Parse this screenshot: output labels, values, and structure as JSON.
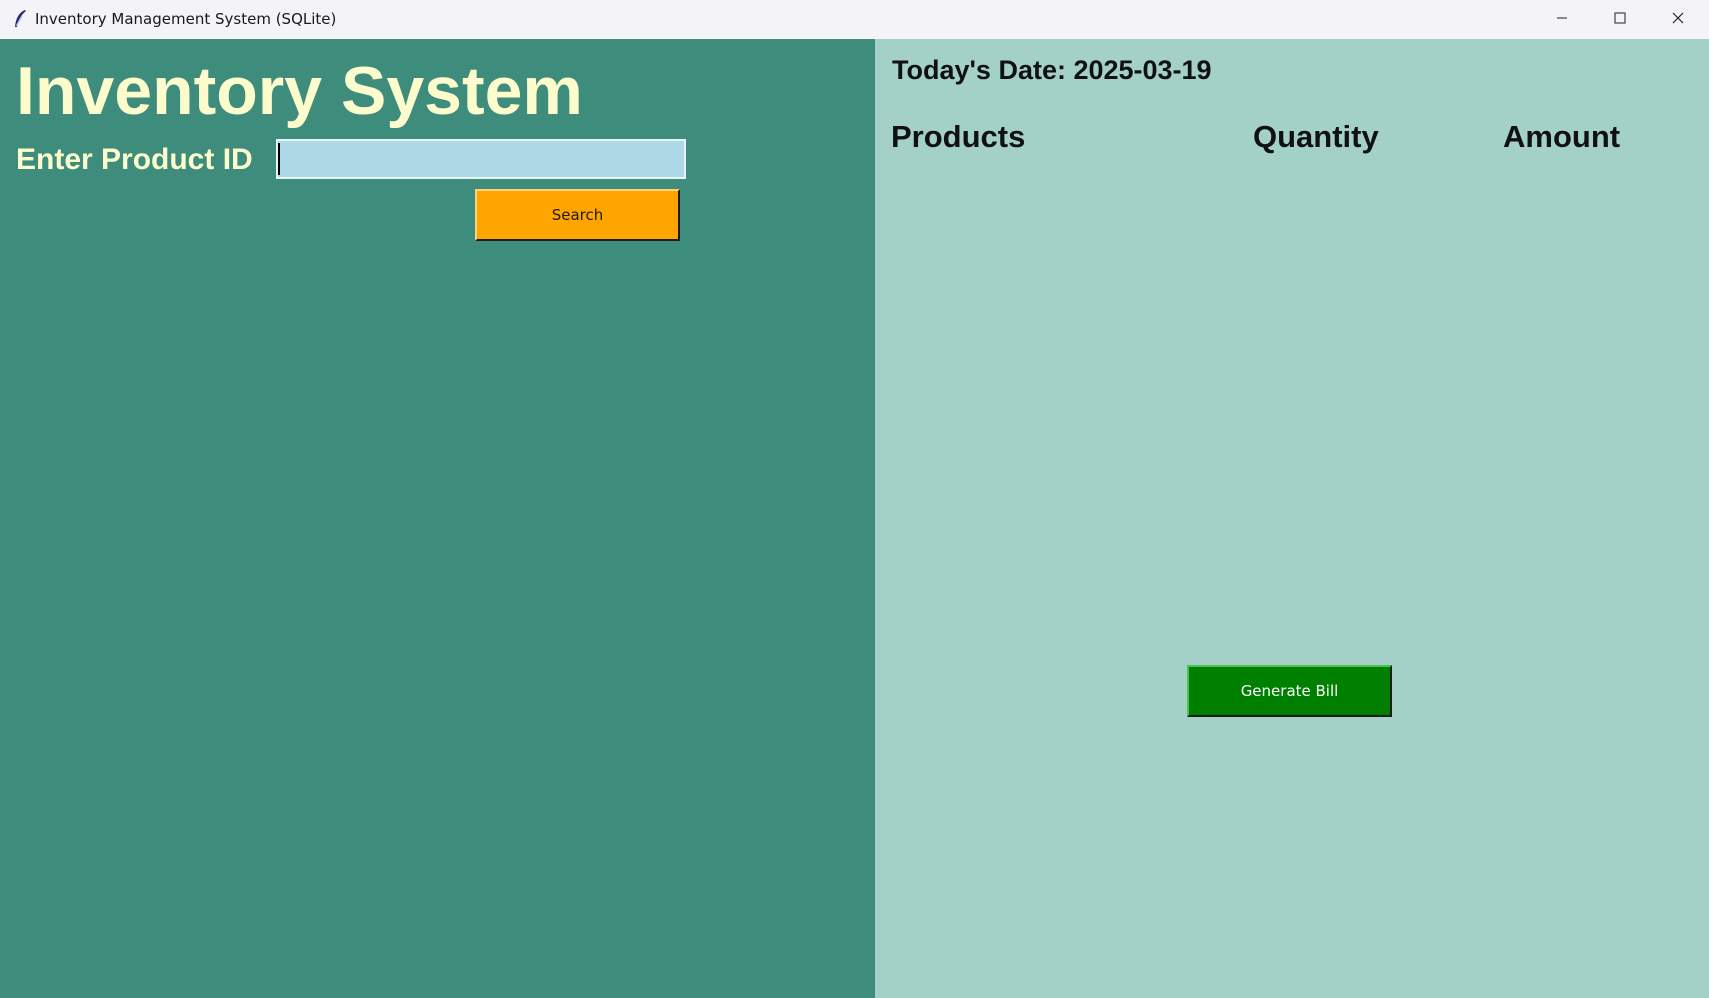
{
  "window": {
    "title": "Inventory Management System (SQLite)",
    "icons": {
      "app": "feather-icon",
      "minimize": "minimize-icon",
      "maximize": "maximize-icon",
      "close": "close-icon"
    }
  },
  "left": {
    "heading": "Inventory System",
    "product_id_label": "Enter Product ID",
    "product_id_value": "",
    "search_label": "Search"
  },
  "right": {
    "date_label": "Today's Date: 2025-03-19",
    "columns": [
      "Products",
      "Quantity",
      "Amount"
    ],
    "generate_bill_label": "Generate Bill"
  },
  "colors": {
    "left_panel_bg": "#3e8c7c",
    "right_panel_bg": "#a4d1c7",
    "heading_text": "#fdfccc",
    "input_bg": "#add8e6",
    "search_button": "#ffa500",
    "generate_bill_button": "#008000"
  }
}
